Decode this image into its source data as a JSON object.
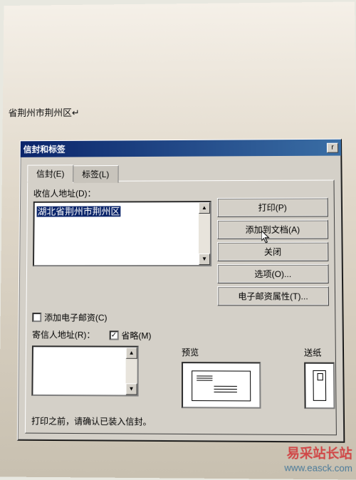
{
  "document": {
    "visible_text": "省荆州市荆州区↵"
  },
  "dialog": {
    "title": "信封和标签",
    "close": "r",
    "tabs": {
      "envelope": "信封(E)",
      "label": "标签(L)"
    },
    "recipient": {
      "label": "收信人地址(D)：",
      "value": "湖北省荆州市荆州区"
    },
    "add_postage": {
      "label": "添加电子邮资(C)",
      "checked": false
    },
    "sender": {
      "label": "寄信人地址(R)：",
      "omit_label": "省略(M)",
      "omit_checked": true,
      "value": ""
    },
    "buttons": {
      "print": "打印(P)",
      "add_to_doc": "添加到文档(A)",
      "close": "关闭",
      "options": "选项(O)...",
      "epostage_props": "电子邮资属性(T)..."
    },
    "preview_label": "预览",
    "feed_label": "送纸",
    "hint": "打印之前，请确认已装入信封。"
  },
  "watermark": {
    "site_name": "易采站长站",
    "url": "www.easck.com"
  }
}
